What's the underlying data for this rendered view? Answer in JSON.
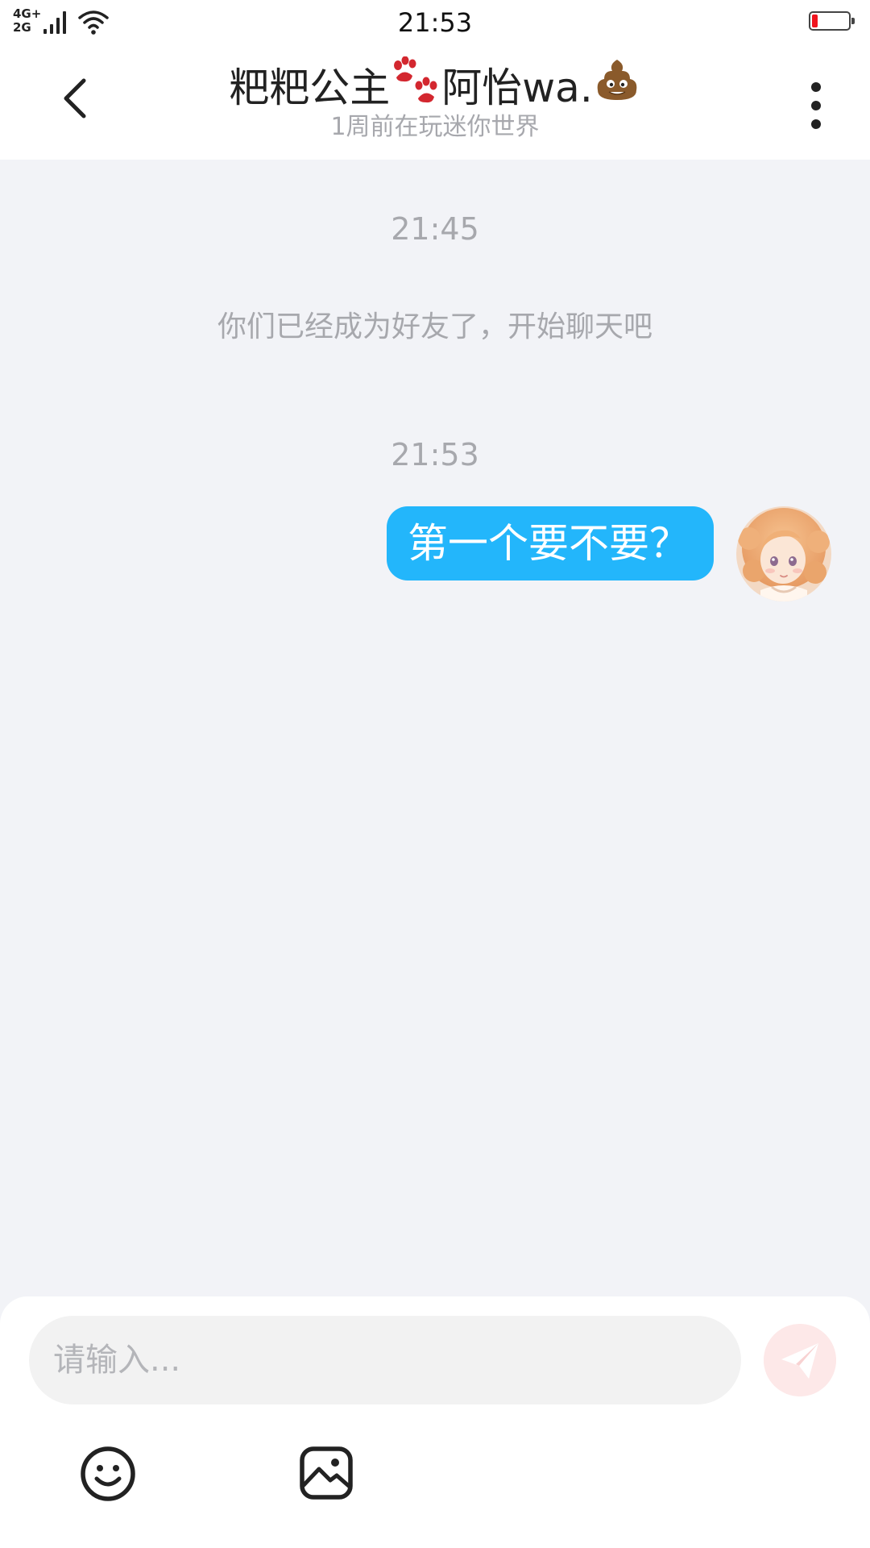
{
  "status_bar": {
    "network_top": "4G+",
    "network_bottom": "2G",
    "time": "21:53",
    "battery_level": 0.15,
    "battery_color": "#f0141e"
  },
  "header": {
    "back_icon": "chevron-left-icon",
    "title_part1": "粑粑公主",
    "title_part2": "阿怡wa.",
    "title_icons": [
      "paw-print-icon",
      "poop-icon"
    ],
    "subtitle": "1周前在玩迷你世界",
    "more_icon": "vertical-dots-icon"
  },
  "chat": {
    "messages": [
      {
        "kind": "timestamp",
        "text": "21:45"
      },
      {
        "kind": "system",
        "text": "你们已经成为好友了，开始聊天吧"
      },
      {
        "kind": "timestamp",
        "text": "21:53"
      },
      {
        "kind": "outgoing",
        "text": "第一个要不要？",
        "bubble_color": "#23b6fb"
      }
    ]
  },
  "input": {
    "placeholder": "请输入...",
    "value": "",
    "send_icon": "paper-plane-icon",
    "emoji_icon": "smiley-icon",
    "image_icon": "image-icon"
  },
  "colors": {
    "background": "#f2f3f7",
    "muted_text": "#a7a8ad",
    "accent": "#23b6fb",
    "send_inactive": "#fde8e8"
  }
}
